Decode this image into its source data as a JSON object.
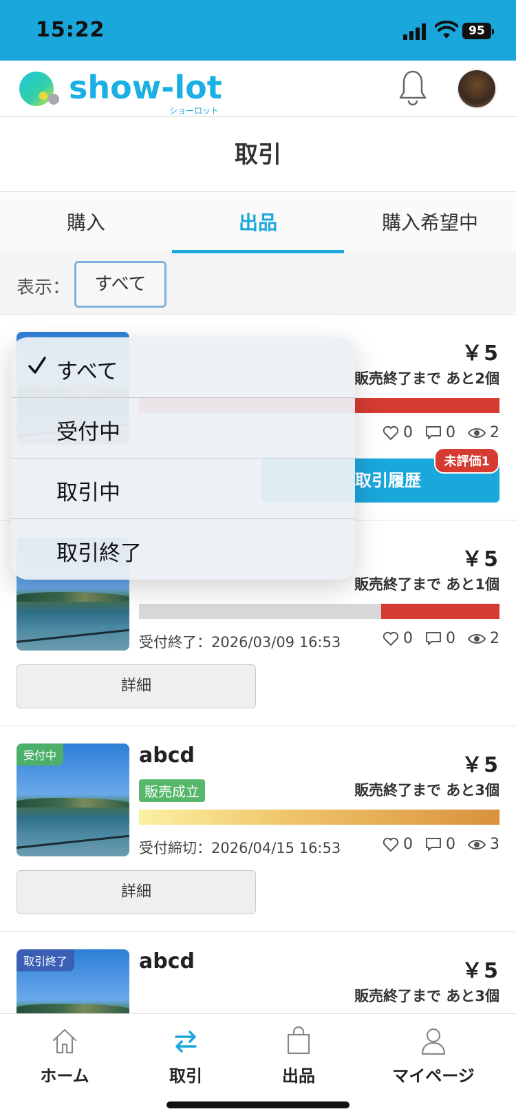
{
  "status_bar": {
    "time": "15:22",
    "battery": "95"
  },
  "header": {
    "logo_text": "show-lot",
    "logo_sub": "ショーロット"
  },
  "page": {
    "title": "取引"
  },
  "tabs": [
    {
      "label": "購入",
      "active": false
    },
    {
      "label": "出品",
      "active": true
    },
    {
      "label": "購入希望中",
      "active": false
    }
  ],
  "filter": {
    "label": "表示：",
    "selected": "すべて"
  },
  "dropdown": {
    "options": [
      {
        "label": "すべて",
        "checked": true
      },
      {
        "label": "受付中",
        "checked": false
      },
      {
        "label": "取引中",
        "checked": false
      },
      {
        "label": "取引終了",
        "checked": false
      }
    ]
  },
  "listings": [
    {
      "price": "￥5",
      "remaining": "販売終了まで あと2個",
      "likes": "0",
      "comments": "0",
      "views": "2",
      "history_button": "取引履歴",
      "unrated_badge": "未評価1"
    },
    {
      "price": "￥5",
      "remaining": "販売終了まで あと1個",
      "date": "受付終了：2026/03/09 16:53",
      "likes": "0",
      "comments": "0",
      "views": "2",
      "detail_button": "詳細"
    },
    {
      "badge": "受付中",
      "title": "abcd",
      "price": "￥5",
      "sold_tag": "販売成立",
      "remaining": "販売終了まで あと3個",
      "date": "受付締切：2026/04/15 16:53",
      "likes": "0",
      "comments": "0",
      "views": "3",
      "detail_button": "詳細"
    },
    {
      "badge": "取引終了",
      "title": "abcd",
      "price": "￥5",
      "remaining": "販売終了まで あと3個"
    }
  ],
  "bottom_nav": [
    {
      "label": "ホーム",
      "icon": "home-icon"
    },
    {
      "label": "取引",
      "icon": "transfer-icon"
    },
    {
      "label": "出品",
      "icon": "shopping-bag-icon"
    },
    {
      "label": "マイページ",
      "icon": "person-icon"
    }
  ],
  "colors": {
    "accent": "#1aa7dc",
    "red": "#d63b31",
    "green": "#4caf6a"
  }
}
